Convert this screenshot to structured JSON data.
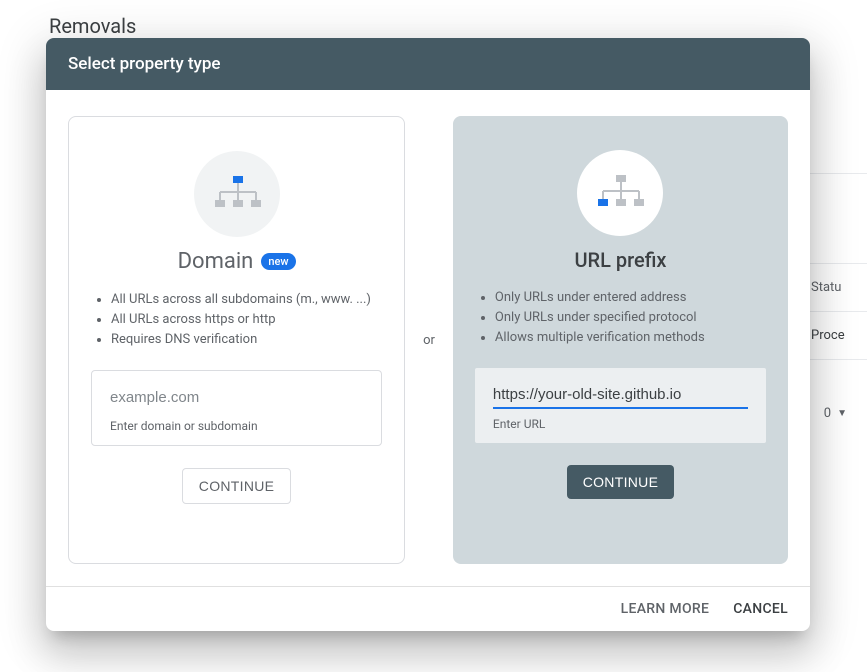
{
  "background": {
    "page_title": "Removals",
    "status_header": "Statu",
    "status_value": "Proce",
    "rows_number": "0",
    "arrow": "▼"
  },
  "modal": {
    "title": "Select property type",
    "or_label": "or",
    "domain": {
      "title": "Domain",
      "new_badge": "new",
      "bullets": [
        "All URLs across all subdomains (m., www. ...)",
        "All URLs across https or http",
        "Requires DNS verification"
      ],
      "placeholder": "example.com",
      "helper": "Enter domain or subdomain",
      "value": "",
      "continue": "CONTINUE"
    },
    "url_prefix": {
      "title": "URL prefix",
      "bullets": [
        "Only URLs under entered address",
        "Only URLs under specified protocol",
        "Allows multiple verification methods"
      ],
      "value": "https://your-old-site.github.io",
      "helper": "Enter URL",
      "continue": "CONTINUE"
    },
    "footer": {
      "learn_more": "LEARN MORE",
      "cancel": "CANCEL"
    }
  }
}
